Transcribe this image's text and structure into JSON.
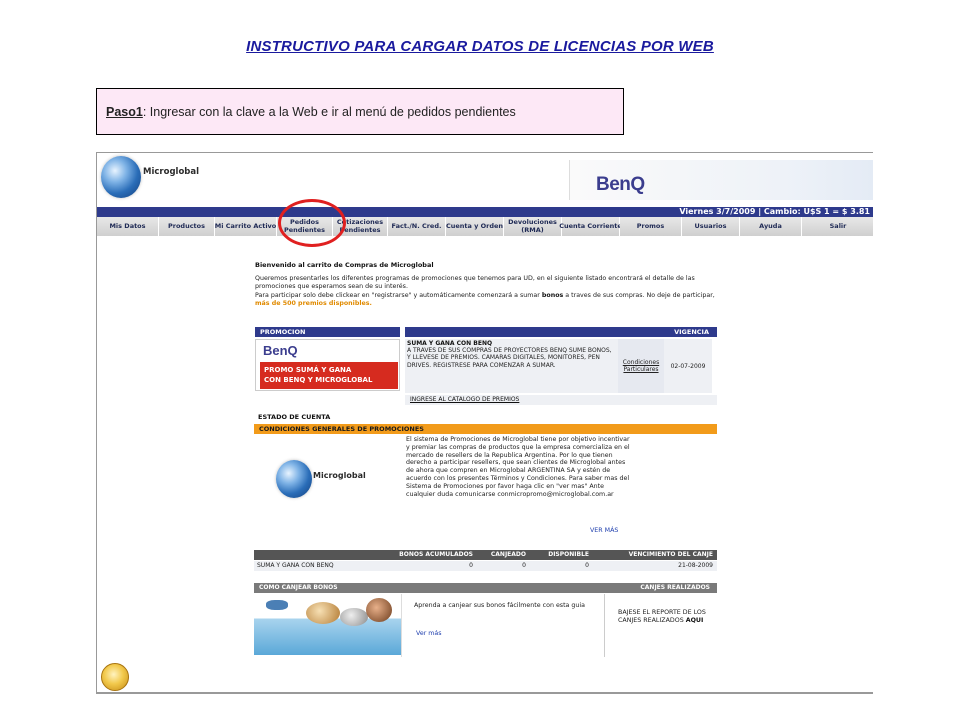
{
  "doc": {
    "title": "INSTRUCTIVO PARA CARGAR DATOS DE LICENCIAS POR WEB",
    "step_label": "Paso1",
    "step_text": ": Ingresar con la clave a la Web e ir al menú de  pedidos pendientes"
  },
  "site": {
    "brand": "Microglobal",
    "partner_logo": "BenQ",
    "date_bar": "Viernes 3/7/2009  |  Cambio: U$S 1 = $ 3.81",
    "nav": [
      "Mis Datos",
      "Productos",
      "Mi Carrito Activo",
      "Pedidos Pendientes",
      "Cotizaciones Pendientes",
      "Fact./N. Cred.",
      "Cuenta y Orden",
      "Devoluciones (RMA)",
      "Cuenta Corriente",
      "Promos",
      "Usuarios",
      "Ayuda",
      "Salir"
    ],
    "highlight_color": "#e02020"
  },
  "welcome": {
    "heading": "Bienvenido al carrito de Compras de Microglobal",
    "p1": "Queremos presentarles los diferentes programas de promociones que tenemos para UD, en el siguiente listado encontrará el detalle de las promociones que esperamos sean de su interés.",
    "p2a": "Para participar solo debe clickear en \"registrarse\" y automáticamente comenzará a sumar ",
    "p2b": "bonos",
    "p2c": " a traves de sus compras. No deje de participar, ",
    "p2d": "más de 500 premios disponibles."
  },
  "promo": {
    "col_promo": "PROMOCION",
    "col_vigencia": "VIGENCIA",
    "img_logo": "BenQ",
    "img_line1": "PROMO SUMÁ Y GANA",
    "img_line2": "CON BENQ Y MICROGLOBAL",
    "desc_title": "SUMA Y GANA CON BENQ",
    "desc_body": "A TRAVES DE SUS COMPRAS DE PROYECTORES BENQ SUME BONOS, Y LLEVESE DE PREMIOS. CAMARAS DIGITALES, MONITORES, PEN DRIVES. REGISTRESE PARA COMENZAR A SUMAR.",
    "conditions": "Condiciones Particulares",
    "date": "02-07-2009",
    "catalog_link": "INGRESE AL CATALOGO DE PREMIOS"
  },
  "estado": {
    "title": "ESTADO DE CUENTA",
    "cond_bar": "CONDICIONES GENERALES DE PROMOCIONES",
    "brand": "Microglobal",
    "text": "El sistema de Promociones de Microglobal tiene por objetivo incentivar y premiar las compras de productos que la empresa comercializa en el mercado de resellers de la Republica Argentina. Por lo que tienen derecho a participar resellers, que sean clientes de Microglobal antes de ahora que compren en Microglobal ARGENTINA SA y estén de acuerdo con los presentes Términos y Condiciones. Para saber mas del Sistema de Promociones por favor haga clic en \"ver mas\" Ante cualquier duda comunicarse conmicropromo@microglobal.com.ar",
    "ver_mas": "VER MÁS"
  },
  "bonos": {
    "headers": [
      "",
      "BONOS ACUMULADOS",
      "CANJEADO",
      "DISPONIBLE",
      "VENCIMIENTO DEL CANJE"
    ],
    "row": [
      "SUMA Y GANA CON BENQ",
      "0",
      "0",
      "0",
      "21-08-2009"
    ]
  },
  "canje": {
    "left_header": "COMO CANJEAR BONOS",
    "right_header": "CANJES REALIZADOS",
    "guide_text": "Aprenda a canjear sus bonos fácilmente con esta guia",
    "ver_mas": "Ver más",
    "report_text": "BAJESE EL REPORTE DE LOS CANJES REALIZADOS ",
    "report_link": "AQUI"
  }
}
